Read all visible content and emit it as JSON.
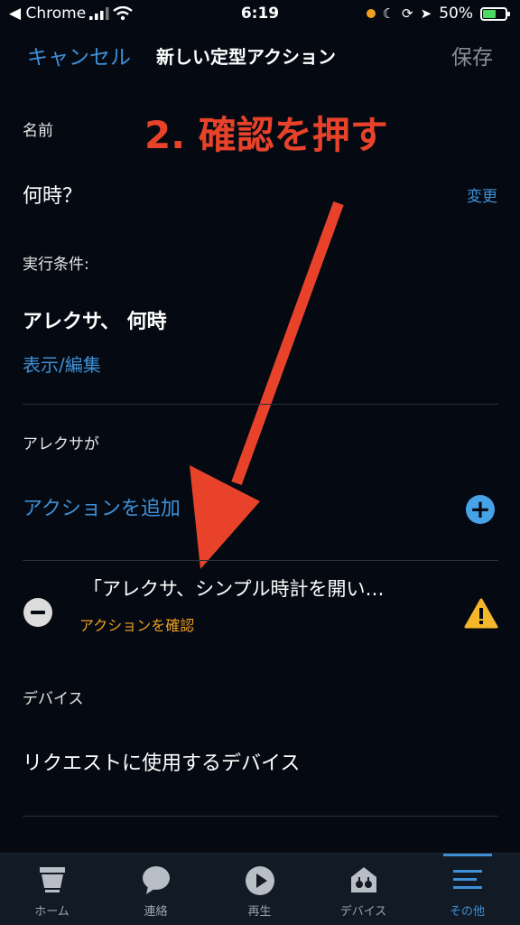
{
  "status_bar": {
    "back_app": "◀ Chrome",
    "time": "6:19",
    "battery_percent": "50%"
  },
  "header": {
    "cancel": "キャンセル",
    "title": "新しい定型アクション",
    "save": "保存"
  },
  "annotation": {
    "text": "2. 確認を押す",
    "color": "#e8432a"
  },
  "name_section": {
    "label": "名前",
    "value": "何時？",
    "change": "変更"
  },
  "trigger_section": {
    "label": "実行条件:",
    "value": "アレクサ、 何時",
    "view_edit": "表示/編集"
  },
  "alexa_section": {
    "label": "アレクサが",
    "add_action": "アクションを追加",
    "action_text": "「アレクサ、シンプル時計を開い…",
    "action_warning": "アクションを確認"
  },
  "device_section": {
    "label": "デバイス",
    "value": "リクエストに使用するデバイス"
  },
  "bottom_nav": {
    "items": [
      {
        "label": "ホーム",
        "icon": "home-icon"
      },
      {
        "label": "連絡",
        "icon": "chat-bubble-icon"
      },
      {
        "label": "再生",
        "icon": "play-icon"
      },
      {
        "label": "デバイス",
        "icon": "devices-icon"
      },
      {
        "label": "その他",
        "icon": "menu-icon"
      }
    ],
    "active_index": 4
  },
  "colors": {
    "accent": "#3f8fd6",
    "warning": "#f0a020",
    "background": "#050a12"
  }
}
